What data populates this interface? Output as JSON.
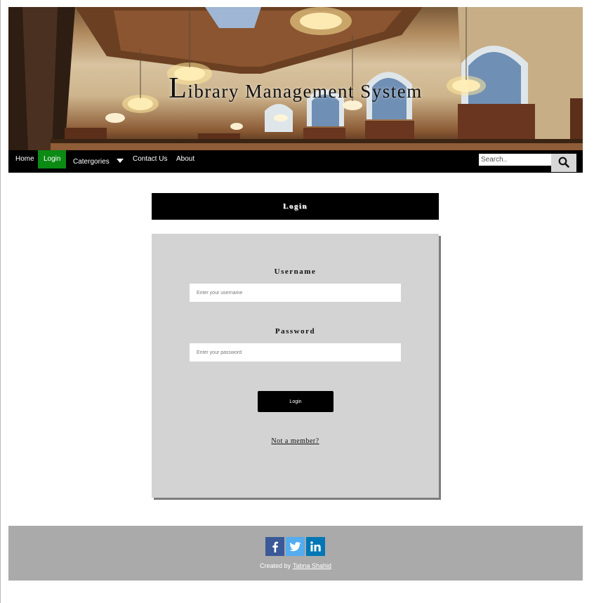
{
  "banner": {
    "title_cap": "L",
    "title_rest": "ibrary Management System"
  },
  "nav": {
    "items": [
      {
        "label": "Home"
      },
      {
        "label": "Login"
      },
      {
        "label": "Catergories"
      },
      {
        "label": "Contact Us"
      },
      {
        "label": "About"
      }
    ],
    "active_item": "Login",
    "search": {
      "placeholder": "Search.."
    }
  },
  "login": {
    "header": "Login",
    "username_label": "Username",
    "username_placeholder": "Enter your username",
    "username_value": "",
    "password_label": "Password",
    "password_placeholder": "Enter your password",
    "password_value": "",
    "submit_label": "Login",
    "member_link": "Not a member?"
  },
  "footer": {
    "credit_prefix": "Created by",
    "author": "Tabna Shahid",
    "social": [
      "facebook-icon",
      "twitter-icon",
      "linkedin-icon"
    ]
  },
  "colors": {
    "nav_active": "#0b8a14",
    "card_bg": "#d3d3d3",
    "footer_bg": "#aaaaaa",
    "facebook": "#3b5998",
    "twitter": "#55acee",
    "linkedin": "#0077b5"
  }
}
